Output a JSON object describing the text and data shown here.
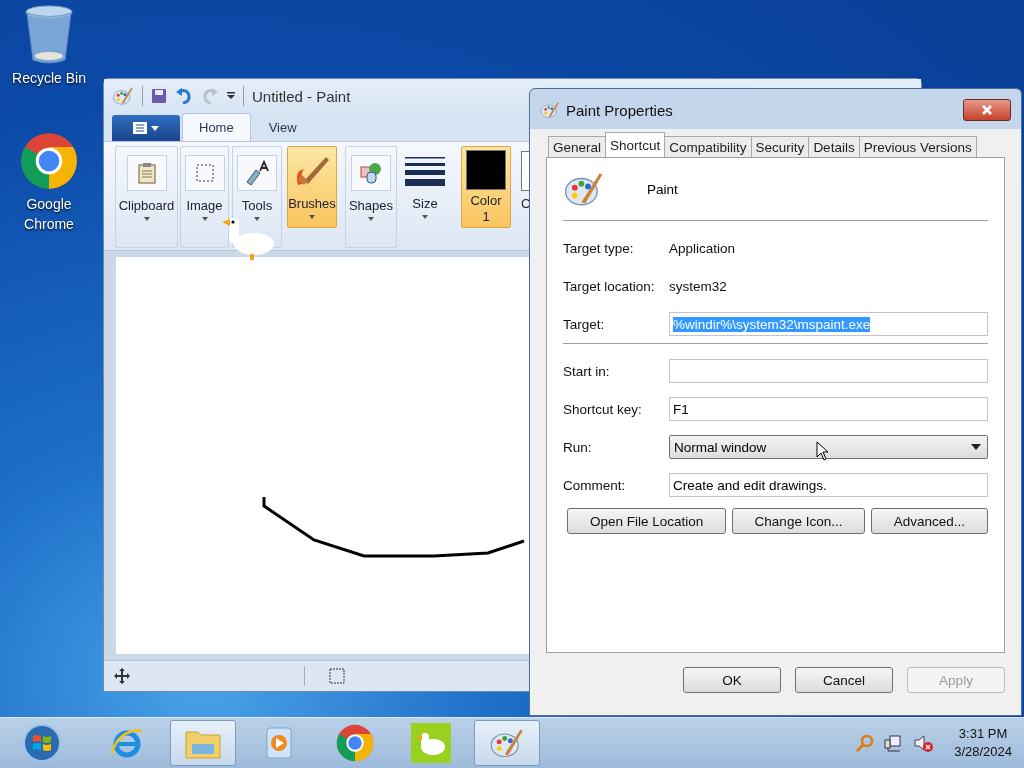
{
  "desktop_icons": [
    {
      "kind": "recycle",
      "label": "Recycle Bin"
    },
    {
      "kind": "chrome",
      "label": "Google Chrome"
    }
  ],
  "paint": {
    "title": "Untitled - Paint",
    "tabs": [
      {
        "label": "Home",
        "selected": true
      },
      {
        "label": "View",
        "selected": false
      }
    ],
    "ribbon": [
      {
        "kind": "clipboard",
        "label": "Clipboard",
        "selected": false
      },
      {
        "kind": "image",
        "label": "Image",
        "selected": false
      },
      {
        "kind": "tools",
        "label": "Tools",
        "selected": false
      },
      {
        "kind": "brushes",
        "label": "Brushes",
        "selected": true
      },
      {
        "kind": "shapes",
        "label": "Shapes",
        "selected": false
      },
      {
        "kind": "size",
        "label": "Size",
        "selected": false
      },
      {
        "kind": "color",
        "label": "Color 1",
        "selected": true
      },
      {
        "kind": "color2",
        "label": "C"
      }
    ]
  },
  "dialog": {
    "title": "Paint Properties",
    "tabs": [
      {
        "label": "General",
        "selected": false
      },
      {
        "label": "Shortcut",
        "selected": true
      },
      {
        "label": "Compatibility",
        "selected": false
      },
      {
        "label": "Security",
        "selected": false
      },
      {
        "label": "Details",
        "selected": false
      },
      {
        "label": "Previous Versions",
        "selected": false
      }
    ],
    "app_name": "Paint",
    "info": [
      {
        "label": "Target type:",
        "value": "Application"
      },
      {
        "label": "Target location:",
        "value": "system32"
      }
    ],
    "target": {
      "label": "Target:",
      "value": "%windir%\\system32\\mspaint.exe",
      "selected": true
    },
    "fields": [
      {
        "kind": "input",
        "label": "Start in:"
      },
      {
        "kind": "input",
        "label": "Shortcut key:",
        "value": "F1"
      },
      {
        "kind": "select",
        "label": "Run:",
        "value": "Normal window"
      },
      {
        "kind": "input",
        "label": "Comment:",
        "value": "Create and edit drawings."
      }
    ],
    "buttons": [
      "Open File Location",
      "Change Icon...",
      "Advanced..."
    ],
    "footer": [
      {
        "label": "OK",
        "disabled": false
      },
      {
        "label": "Cancel",
        "disabled": false
      },
      {
        "label": "Apply",
        "disabled": true
      }
    ]
  },
  "taskbar": {
    "apps": [
      {
        "kind": "ie",
        "open": false
      },
      {
        "kind": "explorer",
        "open": true
      },
      {
        "kind": "media",
        "open": false
      },
      {
        "kind": "chrome",
        "open": false
      },
      {
        "kind": "goose",
        "open": false
      },
      {
        "kind": "paint",
        "open": true
      }
    ],
    "time": "3:31 PM",
    "date": "3/28/2024"
  }
}
